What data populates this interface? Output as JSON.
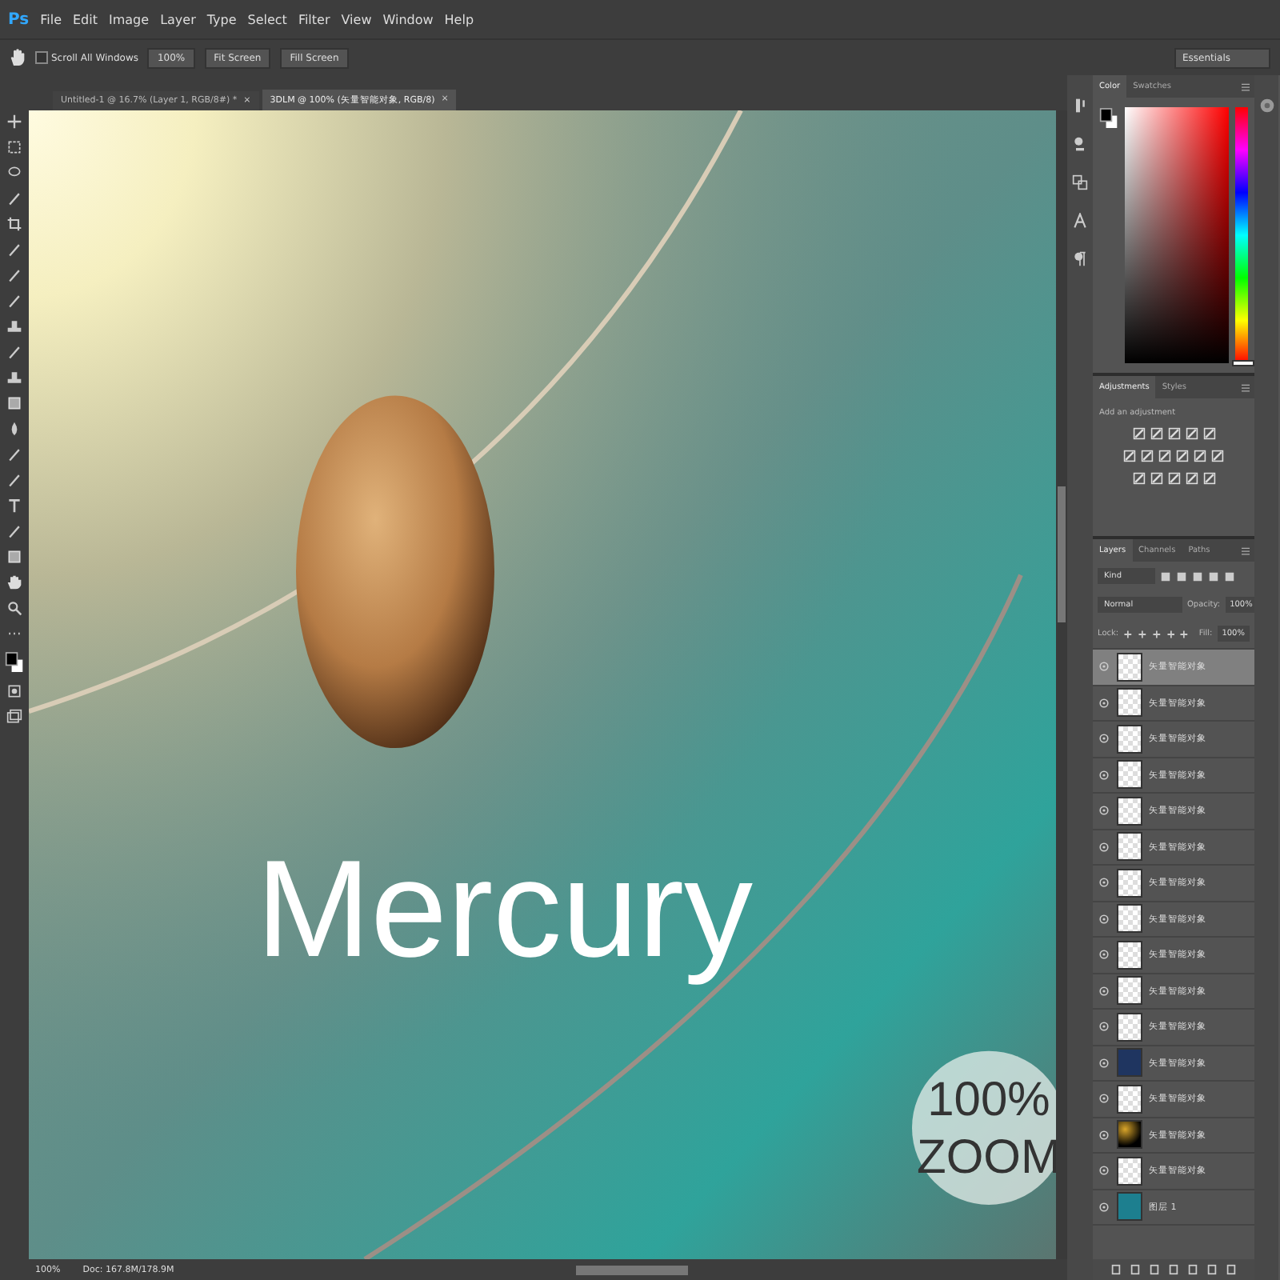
{
  "menu_bar": {
    "logo": "Ps",
    "items": [
      "File",
      "Edit",
      "Image",
      "Layer",
      "Type",
      "Select",
      "Filter",
      "View",
      "Window",
      "Help"
    ]
  },
  "options_bar": {
    "scroll_all": {
      "label": "Scroll All Windows",
      "checked": false
    },
    "buttons": [
      "100%",
      "Fit Screen",
      "Fill Screen"
    ],
    "workspace": "Essentials"
  },
  "document_tabs": [
    {
      "label": "Untitled-1 @ 16.7% (Layer 1, RGB/8#) *",
      "close": "×",
      "selected": false
    },
    {
      "label": "3DLM @ 100% (矢量智能对象, RGB/8)",
      "close": "×",
      "selected": true
    }
  ],
  "canvas": {
    "title": "Mercury",
    "badge_lines": [
      "100%",
      "ZOOM"
    ]
  },
  "status_bar": {
    "zoom": "100%",
    "doc": "Doc: 167.8M/178.9M"
  },
  "color_panel": {
    "tabs": [
      {
        "label": "Color",
        "selected": true
      },
      {
        "label": "Swatches",
        "selected": false
      }
    ],
    "hue": {
      "level": 0
    }
  },
  "adjustments_panel": {
    "tabs": [
      {
        "label": "Adjustments",
        "selected": true
      },
      {
        "label": "Styles",
        "selected": false
      }
    ],
    "hint": "Add an adjustment"
  },
  "layers_panel": {
    "tabs": [
      {
        "label": "Layers",
        "selected": true
      },
      {
        "label": "Channels",
        "selected": false
      },
      {
        "label": "Paths",
        "selected": false
      }
    ],
    "filter": "Kind",
    "blend_mode": "Normal",
    "opacity_label": "Opacity:",
    "opacity": "100%",
    "lock_label": "Lock:",
    "fill_label": "Fill:",
    "fill": "100%",
    "layers": [
      {
        "name": "矢量智能对象",
        "visible": true,
        "selected": true,
        "kind": "transparent"
      },
      {
        "name": "矢量智能对象",
        "visible": true,
        "selected": false,
        "kind": "transparent"
      },
      {
        "name": "矢量智能对象",
        "visible": true,
        "selected": false,
        "kind": "transparent"
      },
      {
        "name": "矢量智能对象",
        "visible": true,
        "selected": false,
        "kind": "transparent"
      },
      {
        "name": "矢量智能对象",
        "visible": true,
        "selected": false,
        "kind": "transparent"
      },
      {
        "name": "矢量智能对象",
        "visible": true,
        "selected": false,
        "kind": "transparent"
      },
      {
        "name": "矢量智能对象",
        "visible": true,
        "selected": false,
        "kind": "transparent"
      },
      {
        "name": "矢量智能对象",
        "visible": true,
        "selected": false,
        "kind": "transparent"
      },
      {
        "name": "矢量智能对象",
        "visible": true,
        "selected": false,
        "kind": "transparent"
      },
      {
        "name": "矢量智能对象",
        "visible": true,
        "selected": false,
        "kind": "transparent"
      },
      {
        "name": "矢量智能对象",
        "visible": true,
        "selected": false,
        "kind": "transparent"
      },
      {
        "name": "矢量智能对象",
        "visible": true,
        "selected": false,
        "kind": "dark"
      },
      {
        "name": "矢量智能对象",
        "visible": true,
        "selected": false,
        "kind": "transparent"
      },
      {
        "name": "矢量智能对象",
        "visible": true,
        "selected": false,
        "kind": "glow"
      },
      {
        "name": "矢量智能对象",
        "visible": true,
        "selected": false,
        "kind": "transparent"
      },
      {
        "name": "图层 1",
        "visible": true,
        "selected": false,
        "kind": "photo"
      }
    ]
  }
}
